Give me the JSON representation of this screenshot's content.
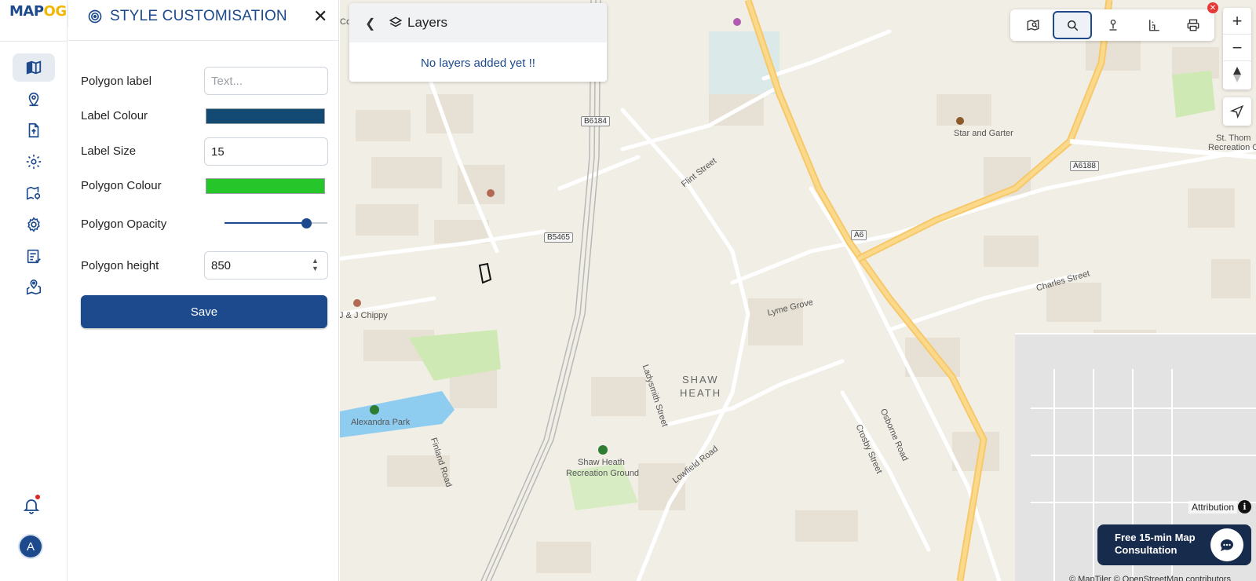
{
  "app": {
    "logo_main": "MAP",
    "logo_accent": "OG"
  },
  "rail": {
    "items": [
      {
        "name": "map-icon",
        "active": true
      },
      {
        "name": "location-pin-icon",
        "active": false
      },
      {
        "name": "file-upload-icon",
        "active": false
      },
      {
        "name": "settings-icon",
        "active": false
      },
      {
        "name": "map-marker-edit-icon",
        "active": false
      },
      {
        "name": "gear-icon",
        "active": false
      },
      {
        "name": "report-icon",
        "active": false
      },
      {
        "name": "map-location-icon",
        "active": false
      }
    ],
    "avatar_initial": "A"
  },
  "panel": {
    "title": "STYLE CUSTOMISATION",
    "close_glyph": "✕",
    "polygon_label": {
      "label": "Polygon label",
      "value": "",
      "placeholder": "Text..."
    },
    "label_colour": {
      "label": "Label Colour",
      "color": "#134a74"
    },
    "label_size": {
      "label": "Label Size",
      "value": "15"
    },
    "polygon_colour": {
      "label": "Polygon Colour",
      "color": "#26c62a"
    },
    "polygon_opacity": {
      "label": "Polygon Opacity",
      "value": 0.8
    },
    "polygon_height": {
      "label": "Polygon height",
      "value": "850"
    },
    "save_label": "Save"
  },
  "layers": {
    "title": "Layers",
    "empty_message": "No layers added yet !!"
  },
  "tools": {
    "items": [
      {
        "name": "map-view-icon",
        "active": false
      },
      {
        "name": "search-icon",
        "active": true
      },
      {
        "name": "person-pin-icon",
        "active": false
      },
      {
        "name": "measure-icon",
        "active": false
      },
      {
        "name": "print-icon",
        "active": false
      }
    ]
  },
  "zoom": {
    "in": "+",
    "out": "−"
  },
  "map": {
    "labels": {
      "star_garter": "Star and Garter",
      "st_thomas": "St. Thom",
      "recreation": "Recreation C",
      "flint_street": "Flint Street",
      "lyme_grove": "Lyme Grove",
      "charles_street": "Charles Street",
      "shaw": "SHAW",
      "heath": "HEATH",
      "ladysmith": "Ladysmith Street",
      "crosby": "Crosby Street",
      "osborne": "Osborne Road",
      "lowfield": "Lowfield Road",
      "shaw_heath_rec_1": "Shaw Heath",
      "shaw_heath_rec_2": "Recreation Ground",
      "alexandra": "Alexandra Park",
      "finland": "Finland Road",
      "chippy": "J & J Chippy",
      "co": "Co"
    },
    "shields": {
      "b6184": "B6184",
      "b5465": "B5465",
      "a6": "A6",
      "a6188": "A6188"
    }
  },
  "attribution": {
    "label": "Attribution",
    "info": "i",
    "copyright": "© MapTiler © OpenStreetMap contributors"
  },
  "consult": {
    "text": "Free 15-min Map Consultation"
  }
}
